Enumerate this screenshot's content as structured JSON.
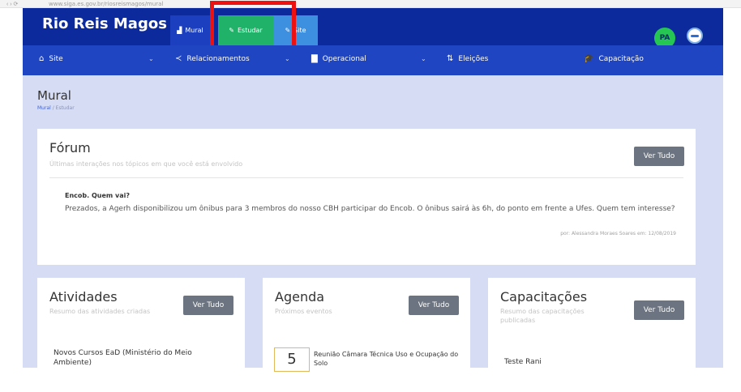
{
  "browser": {
    "url_text": "www.siga.es.gov.br/riosreismagos/mural"
  },
  "topbar": {
    "brand": "Rio Reis Magos",
    "tabs": [
      {
        "label": "Mural",
        "icon": "dashboard-icon"
      },
      {
        "label": "Estudar",
        "icon": "edit-icon"
      },
      {
        "label": "Site",
        "icon": "edit-icon"
      }
    ],
    "user_initials": "PA",
    "colors": {
      "navbar": "#0c2a9b",
      "estudar": "#21b26a",
      "site_tab": "#3d8fe0",
      "highlight": "#ee1111"
    }
  },
  "subnav": {
    "items": [
      {
        "label": "Site",
        "icon": "home-icon"
      },
      {
        "label": "Relacionamentos",
        "icon": "share-icon"
      },
      {
        "label": "Operacional",
        "icon": "bar-chart-icon"
      },
      {
        "label": "Eleições",
        "icon": "sort-icon"
      },
      {
        "label": "Capacitação",
        "icon": "graduation-cap-icon"
      }
    ]
  },
  "page": {
    "title": "Mural",
    "breadcrumb": [
      "Mural",
      "Estudar"
    ]
  },
  "forum": {
    "title": "Fórum",
    "subtitle": "Últimas interações nos tópicos em que você está envolvido",
    "button": "Ver Tudo",
    "post": {
      "title": "Encob. Quem vai?",
      "body": "Prezados, a Agerh disponibilizou um ônibus para 3 membros do nosso CBH participar do Encob.  O ônibus sairá às 6h, do ponto em frente a Ufes. Quem tem interesse?",
      "meta": "por: Alessandra Moraes Soares em: 12/08/2019"
    }
  },
  "atividades": {
    "title": "Atividades",
    "subtitle": "Resumo das atividades criadas",
    "button": "Ver Tudo",
    "item": "Novos Cursos EaD (Ministério do Meio Ambiente)"
  },
  "agenda": {
    "title": "Agenda",
    "subtitle": "Próximos eventos",
    "button": "Ver Tudo",
    "day": "5",
    "item": "Reunião Câmara Técnica Uso e Ocupação do Solo"
  },
  "capacitacoes": {
    "title": "Capacitações",
    "subtitle": "Resumo das capacitações publicadas",
    "button": "Ver Tudo",
    "item": "Teste Rani"
  }
}
